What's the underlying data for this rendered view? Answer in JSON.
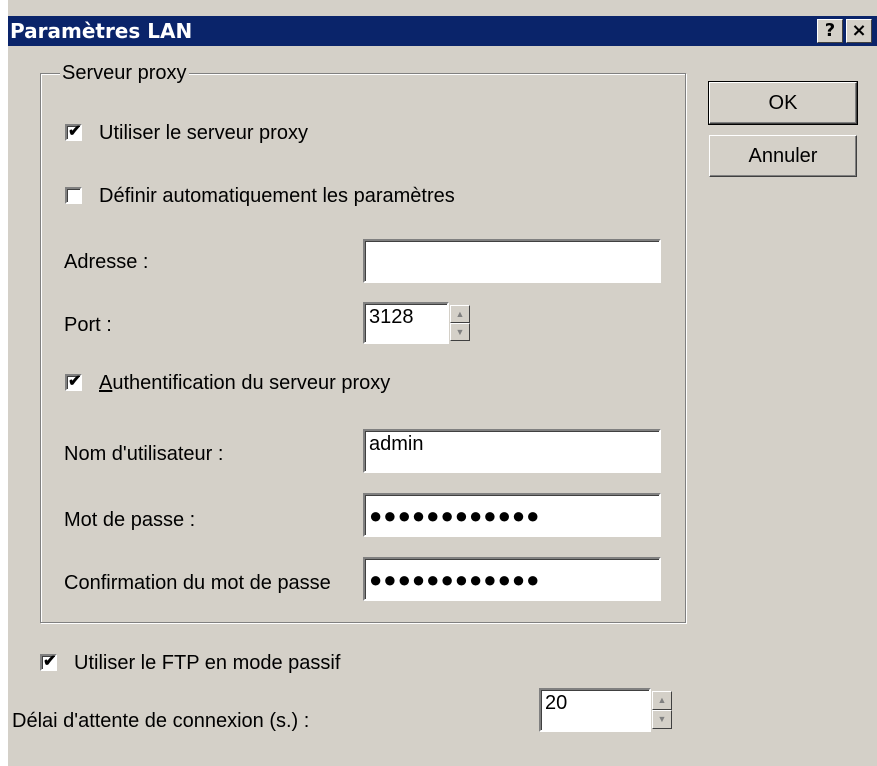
{
  "window": {
    "title": "Paramètres LAN",
    "help_glyph": "?",
    "close_glyph": "×"
  },
  "proxy_group": {
    "legend": "Serveur proxy",
    "use_proxy": {
      "label": "Utiliser le serveur proxy",
      "checked": true
    },
    "auto_config": {
      "label": "Définir automatiquement les paramètres",
      "checked": false
    },
    "address": {
      "label": "Adresse :",
      "value": ""
    },
    "port": {
      "label": "Port :",
      "value": "3128"
    },
    "auth": {
      "label": "Authentification du serveur proxy",
      "accel": "A",
      "label_rest": "uthentification du serveur proxy",
      "checked": true
    },
    "username": {
      "label": "Nom d'utilisateur :",
      "value": "admin"
    },
    "password": {
      "label": "Mot de passe :",
      "value": "●●●●●●●●●●●●"
    },
    "confirm": {
      "label": "Confirmation du mot de passe",
      "value": "●●●●●●●●●●●●"
    }
  },
  "passive_ftp": {
    "label": "Utiliser le FTP en mode passif",
    "checked": true
  },
  "timeout": {
    "label": "Délai d'attente de connexion (s.) :",
    "value": "20"
  },
  "buttons": {
    "ok": "OK",
    "cancel": "Annuler"
  },
  "glyphs": {
    "check": "✔",
    "spin_up": "▲",
    "spin_down": "▼"
  }
}
